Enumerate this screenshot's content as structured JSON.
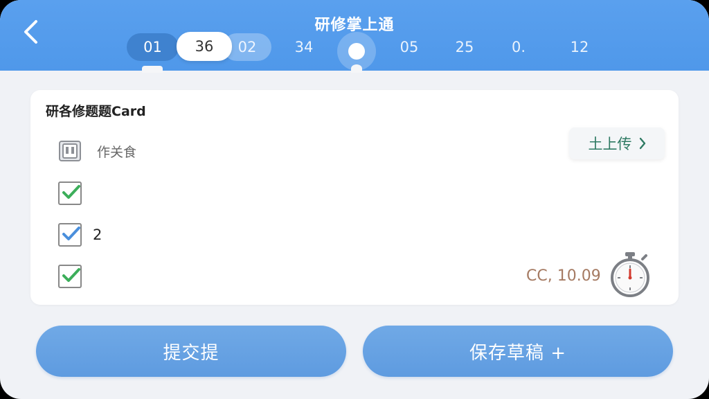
{
  "header": {
    "title": "研修掌上通",
    "back_icon": "chevron-left-icon",
    "question_nav": [
      {
        "label": "01",
        "style": "dark"
      },
      {
        "label": "36",
        "style": "white"
      },
      {
        "label": "02",
        "style": "soft"
      },
      {
        "label": "34",
        "style": "plain"
      },
      {
        "label": "",
        "style": "current"
      },
      {
        "label": "05",
        "style": "plain"
      },
      {
        "label": "25",
        "style": "plain"
      },
      {
        "label": "0.",
        "style": "plain"
      },
      {
        "label": "12",
        "style": "plain"
      }
    ]
  },
  "card": {
    "title": "研各修题题Card",
    "meta_label": "作关食",
    "meta_icon": "document-stack-icon",
    "upload_label": "土上传",
    "options": [
      {
        "label": "",
        "check_color": "#3cae5a"
      },
      {
        "label": "2",
        "check_color": "#4a8fdc"
      },
      {
        "label": "",
        "check_color": "#3cae5a"
      }
    ],
    "timer_text": "CC, 10.09",
    "timer_icon": "stopwatch-icon"
  },
  "actions": {
    "submit_label": "提交提",
    "save_draft_label": "保存草稿 +"
  },
  "colors": {
    "header_blue": "#4f98ea",
    "button_blue": "#6aa4e4",
    "upload_text": "#2e7a63",
    "timer_text": "#a57a62"
  }
}
